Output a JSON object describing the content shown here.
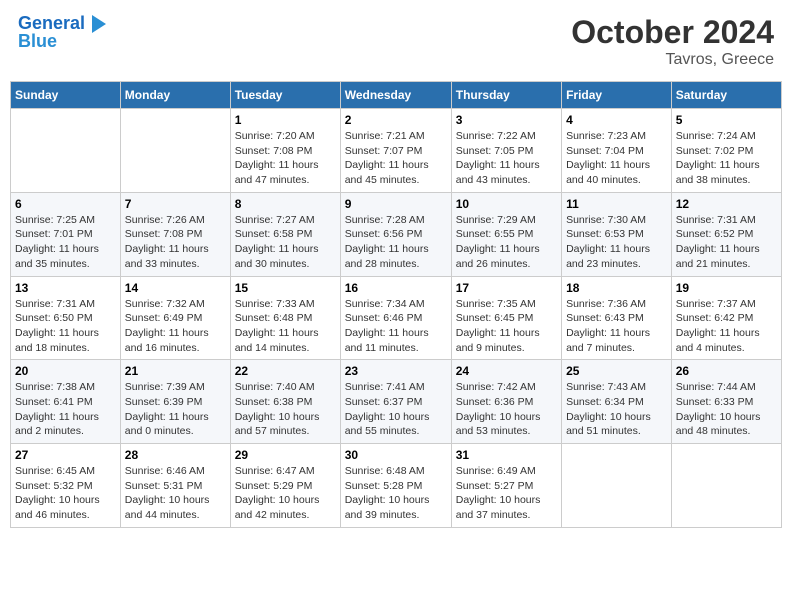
{
  "header": {
    "logo_line1": "General",
    "logo_line2": "Blue",
    "month_title": "October 2024",
    "location": "Tavros, Greece"
  },
  "days_of_week": [
    "Sunday",
    "Monday",
    "Tuesday",
    "Wednesday",
    "Thursday",
    "Friday",
    "Saturday"
  ],
  "weeks": [
    [
      {
        "num": "",
        "sunrise": "",
        "sunset": "",
        "daylight": ""
      },
      {
        "num": "",
        "sunrise": "",
        "sunset": "",
        "daylight": ""
      },
      {
        "num": "1",
        "sunrise": "Sunrise: 7:20 AM",
        "sunset": "Sunset: 7:08 PM",
        "daylight": "Daylight: 11 hours and 47 minutes."
      },
      {
        "num": "2",
        "sunrise": "Sunrise: 7:21 AM",
        "sunset": "Sunset: 7:07 PM",
        "daylight": "Daylight: 11 hours and 45 minutes."
      },
      {
        "num": "3",
        "sunrise": "Sunrise: 7:22 AM",
        "sunset": "Sunset: 7:05 PM",
        "daylight": "Daylight: 11 hours and 43 minutes."
      },
      {
        "num": "4",
        "sunrise": "Sunrise: 7:23 AM",
        "sunset": "Sunset: 7:04 PM",
        "daylight": "Daylight: 11 hours and 40 minutes."
      },
      {
        "num": "5",
        "sunrise": "Sunrise: 7:24 AM",
        "sunset": "Sunset: 7:02 PM",
        "daylight": "Daylight: 11 hours and 38 minutes."
      }
    ],
    [
      {
        "num": "6",
        "sunrise": "Sunrise: 7:25 AM",
        "sunset": "Sunset: 7:01 PM",
        "daylight": "Daylight: 11 hours and 35 minutes."
      },
      {
        "num": "7",
        "sunrise": "Sunrise: 7:26 AM",
        "sunset": "Sunset: 7:08 PM",
        "daylight": "Daylight: 11 hours and 33 minutes."
      },
      {
        "num": "8",
        "sunrise": "Sunrise: 7:27 AM",
        "sunset": "Sunset: 6:58 PM",
        "daylight": "Daylight: 11 hours and 30 minutes."
      },
      {
        "num": "9",
        "sunrise": "Sunrise: 7:28 AM",
        "sunset": "Sunset: 6:56 PM",
        "daylight": "Daylight: 11 hours and 28 minutes."
      },
      {
        "num": "10",
        "sunrise": "Sunrise: 7:29 AM",
        "sunset": "Sunset: 6:55 PM",
        "daylight": "Daylight: 11 hours and 26 minutes."
      },
      {
        "num": "11",
        "sunrise": "Sunrise: 7:30 AM",
        "sunset": "Sunset: 6:53 PM",
        "daylight": "Daylight: 11 hours and 23 minutes."
      },
      {
        "num": "12",
        "sunrise": "Sunrise: 7:31 AM",
        "sunset": "Sunset: 6:52 PM",
        "daylight": "Daylight: 11 hours and 21 minutes."
      }
    ],
    [
      {
        "num": "13",
        "sunrise": "Sunrise: 7:31 AM",
        "sunset": "Sunset: 6:50 PM",
        "daylight": "Daylight: 11 hours and 18 minutes."
      },
      {
        "num": "14",
        "sunrise": "Sunrise: 7:32 AM",
        "sunset": "Sunset: 6:49 PM",
        "daylight": "Daylight: 11 hours and 16 minutes."
      },
      {
        "num": "15",
        "sunrise": "Sunrise: 7:33 AM",
        "sunset": "Sunset: 6:48 PM",
        "daylight": "Daylight: 11 hours and 14 minutes."
      },
      {
        "num": "16",
        "sunrise": "Sunrise: 7:34 AM",
        "sunset": "Sunset: 6:46 PM",
        "daylight": "Daylight: 11 hours and 11 minutes."
      },
      {
        "num": "17",
        "sunrise": "Sunrise: 7:35 AM",
        "sunset": "Sunset: 6:45 PM",
        "daylight": "Daylight: 11 hours and 9 minutes."
      },
      {
        "num": "18",
        "sunrise": "Sunrise: 7:36 AM",
        "sunset": "Sunset: 6:43 PM",
        "daylight": "Daylight: 11 hours and 7 minutes."
      },
      {
        "num": "19",
        "sunrise": "Sunrise: 7:37 AM",
        "sunset": "Sunset: 6:42 PM",
        "daylight": "Daylight: 11 hours and 4 minutes."
      }
    ],
    [
      {
        "num": "20",
        "sunrise": "Sunrise: 7:38 AM",
        "sunset": "Sunset: 6:41 PM",
        "daylight": "Daylight: 11 hours and 2 minutes."
      },
      {
        "num": "21",
        "sunrise": "Sunrise: 7:39 AM",
        "sunset": "Sunset: 6:39 PM",
        "daylight": "Daylight: 11 hours and 0 minutes."
      },
      {
        "num": "22",
        "sunrise": "Sunrise: 7:40 AM",
        "sunset": "Sunset: 6:38 PM",
        "daylight": "Daylight: 10 hours and 57 minutes."
      },
      {
        "num": "23",
        "sunrise": "Sunrise: 7:41 AM",
        "sunset": "Sunset: 6:37 PM",
        "daylight": "Daylight: 10 hours and 55 minutes."
      },
      {
        "num": "24",
        "sunrise": "Sunrise: 7:42 AM",
        "sunset": "Sunset: 6:36 PM",
        "daylight": "Daylight: 10 hours and 53 minutes."
      },
      {
        "num": "25",
        "sunrise": "Sunrise: 7:43 AM",
        "sunset": "Sunset: 6:34 PM",
        "daylight": "Daylight: 10 hours and 51 minutes."
      },
      {
        "num": "26",
        "sunrise": "Sunrise: 7:44 AM",
        "sunset": "Sunset: 6:33 PM",
        "daylight": "Daylight: 10 hours and 48 minutes."
      }
    ],
    [
      {
        "num": "27",
        "sunrise": "Sunrise: 6:45 AM",
        "sunset": "Sunset: 5:32 PM",
        "daylight": "Daylight: 10 hours and 46 minutes."
      },
      {
        "num": "28",
        "sunrise": "Sunrise: 6:46 AM",
        "sunset": "Sunset: 5:31 PM",
        "daylight": "Daylight: 10 hours and 44 minutes."
      },
      {
        "num": "29",
        "sunrise": "Sunrise: 6:47 AM",
        "sunset": "Sunset: 5:29 PM",
        "daylight": "Daylight: 10 hours and 42 minutes."
      },
      {
        "num": "30",
        "sunrise": "Sunrise: 6:48 AM",
        "sunset": "Sunset: 5:28 PM",
        "daylight": "Daylight: 10 hours and 39 minutes."
      },
      {
        "num": "31",
        "sunrise": "Sunrise: 6:49 AM",
        "sunset": "Sunset: 5:27 PM",
        "daylight": "Daylight: 10 hours and 37 minutes."
      },
      {
        "num": "",
        "sunrise": "",
        "sunset": "",
        "daylight": ""
      },
      {
        "num": "",
        "sunrise": "",
        "sunset": "",
        "daylight": ""
      }
    ]
  ]
}
